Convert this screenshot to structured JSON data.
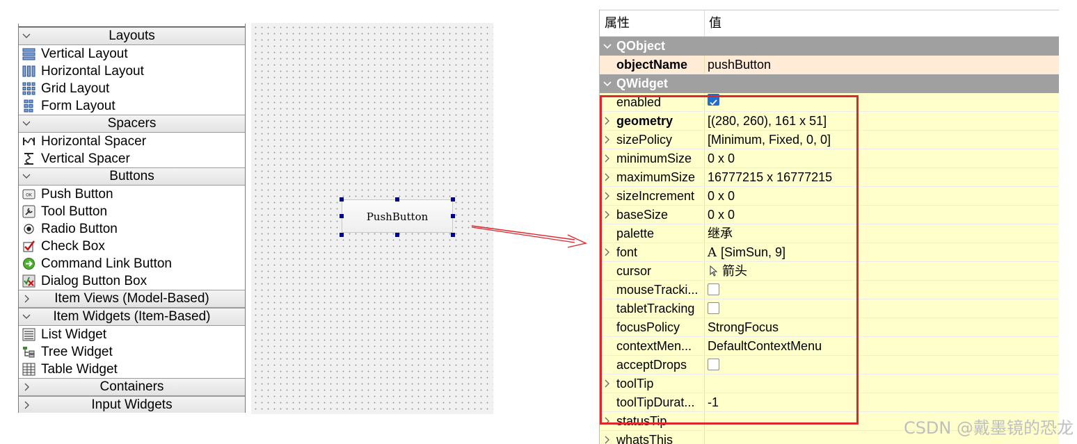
{
  "widget_box": {
    "categories": {
      "layouts": "Layouts",
      "spacers": "Spacers",
      "buttons": "Buttons",
      "item_views": "Item Views (Model-Based)",
      "item_widgets": "Item Widgets (Item-Based)",
      "containers": "Containers",
      "input_widgets": "Input Widgets"
    },
    "layouts": [
      "Vertical Layout",
      "Horizontal Layout",
      "Grid Layout",
      "Form Layout"
    ],
    "spacers": [
      "Horizontal Spacer",
      "Vertical Spacer"
    ],
    "buttons": [
      "Push Button",
      "Tool Button",
      "Radio Button",
      "Check Box",
      "Command Link Button",
      "Dialog Button Box"
    ],
    "item_widgets": [
      "List Widget",
      "Tree Widget",
      "Table Widget"
    ]
  },
  "canvas": {
    "push_button_label": "PushButton"
  },
  "property_editor": {
    "header": {
      "property": "属性",
      "value": "值"
    },
    "groups": {
      "qobject": "QObject",
      "qwidget": "QWidget"
    },
    "object_name": {
      "name": "objectName",
      "value": "pushButton"
    },
    "rows": [
      {
        "name": "enabled",
        "value": ""
      },
      {
        "name": "geometry",
        "value": "[(280, 260), 161 x 51]"
      },
      {
        "name": "sizePolicy",
        "value": "[Minimum, Fixed, 0, 0]"
      },
      {
        "name": "minimumSize",
        "value": "0 x 0"
      },
      {
        "name": "maximumSize",
        "value": "16777215 x 16777215"
      },
      {
        "name": "sizeIncrement",
        "value": "0 x 0"
      },
      {
        "name": "baseSize",
        "value": "0 x 0"
      },
      {
        "name": "palette",
        "value": "继承"
      },
      {
        "name": "font",
        "value": "[SimSun, 9]"
      },
      {
        "name": "cursor",
        "value": "箭头"
      },
      {
        "name": "mouseTracki...",
        "value": ""
      },
      {
        "name": "tabletTracking",
        "value": ""
      },
      {
        "name": "focusPolicy",
        "value": "StrongFocus"
      },
      {
        "name": "contextMen...",
        "value": "DefaultContextMenu"
      },
      {
        "name": "acceptDrops",
        "value": ""
      },
      {
        "name": "toolTip",
        "value": ""
      },
      {
        "name": "toolTipDurat...",
        "value": "-1"
      },
      {
        "name": "statusTip",
        "value": ""
      },
      {
        "name": "whatsThis",
        "value": ""
      }
    ],
    "font_glyph": "A"
  },
  "watermark": "CSDN @戴墨镜的恐龙",
  "colors": {
    "highlight": "#e0262d",
    "arrow": "#e0262d",
    "handle": "#00008b",
    "row_bg": "#ffffcc",
    "object_name_bg": "#ffebd6",
    "group_bg": "#a0a0a0"
  }
}
